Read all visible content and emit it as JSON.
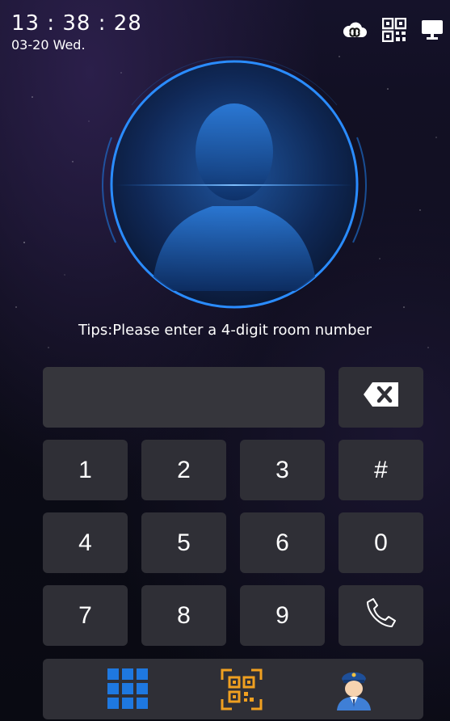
{
  "status": {
    "time": "13 : 38 : 28",
    "date": "03-20 Wed."
  },
  "top_icons": [
    "cloud-link-icon",
    "qr-code-icon",
    "monitor-icon"
  ],
  "tips": "Tips:Please enter a 4-digit room number",
  "input": {
    "value": ""
  },
  "keys": [
    [
      "1",
      "2",
      "3",
      "#"
    ],
    [
      "4",
      "5",
      "6",
      "0"
    ],
    [
      "7",
      "8",
      "9"
    ]
  ],
  "bottom_icons": [
    "apps-grid-icon",
    "qr-scan-icon",
    "security-guard-icon"
  ],
  "colors": {
    "accent_blue": "#1e78e0",
    "qr_orange": "#f0a020",
    "key_bg": "#2f2f36"
  }
}
